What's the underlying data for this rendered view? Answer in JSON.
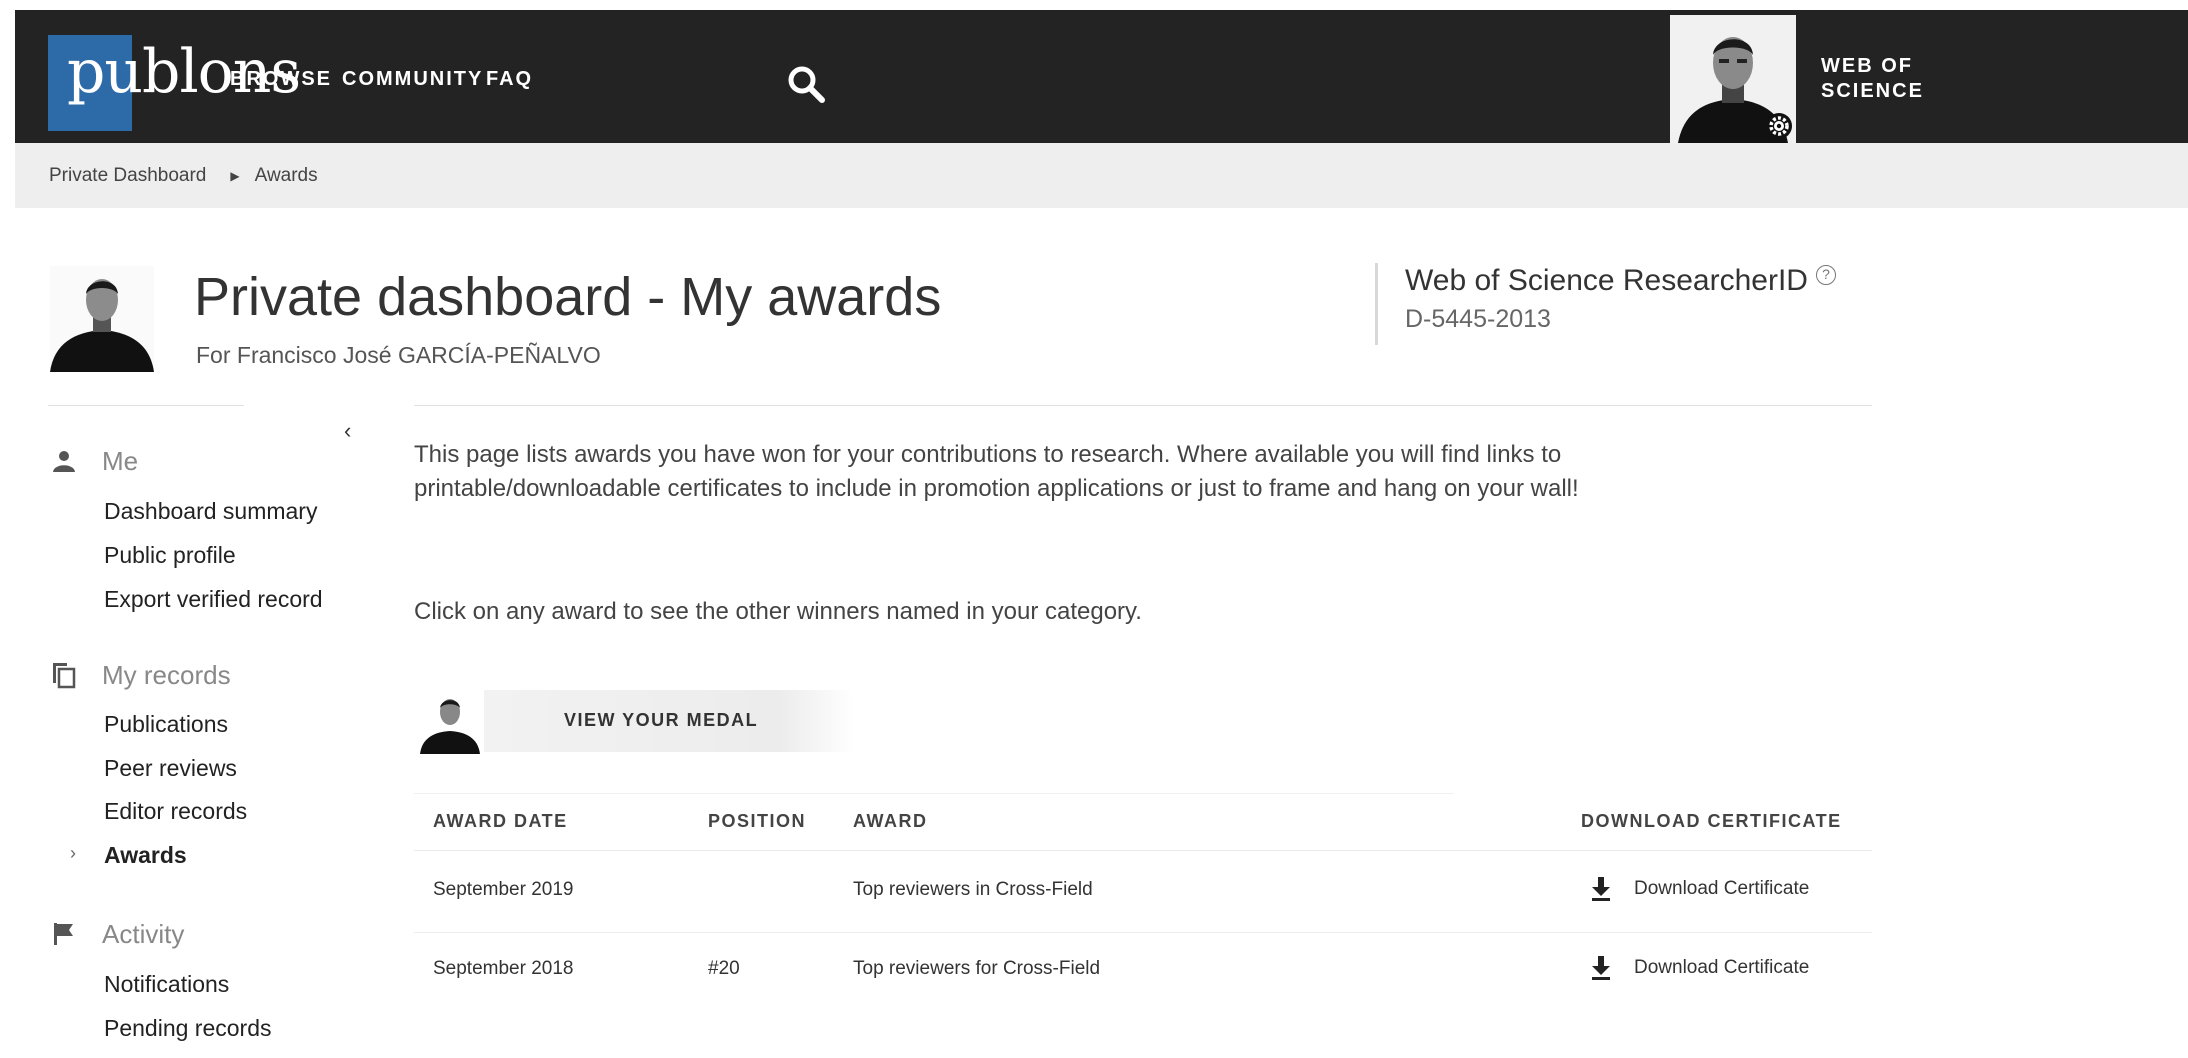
{
  "nav": {
    "logo": "publons",
    "links": [
      "BROWSE",
      "COMMUNITY",
      "FAQ"
    ],
    "wos_line1": "WEB OF",
    "wos_line2": "SCIENCE"
  },
  "breadcrumb": {
    "items": [
      "Private Dashboard",
      "Awards"
    ]
  },
  "header": {
    "title": "Private dashboard - My awards",
    "subtitle": "For Francisco José GARCÍA-PEÑALVO",
    "researcher_id_label": "Web of Science ResearcherID",
    "researcher_id_help": "?",
    "researcher_id": "D-5445-2013"
  },
  "sidebar": {
    "collapse": "‹",
    "sections": [
      {
        "title": "Me",
        "icon": "person-icon",
        "items": [
          "Dashboard summary",
          "Public profile",
          "Export verified record"
        ]
      },
      {
        "title": "My records",
        "icon": "copy-icon",
        "items": [
          "Publications",
          "Peer reviews",
          "Editor records",
          "Awards"
        ]
      },
      {
        "title": "Activity",
        "icon": "flag-icon",
        "items": [
          "Notifications",
          "Pending records"
        ]
      }
    ],
    "active_item": "Awards"
  },
  "content": {
    "intro": "This page lists awards you have won for your contributions to research. Where available you will find links to printable/downloadable certificates to include in promotion applications or just to frame and hang on your wall!",
    "hint": "Click on any award to see the other winners named in your category.",
    "medal_button": "VIEW YOUR MEDAL",
    "table": {
      "headers": [
        "AWARD DATE",
        "POSITION",
        "AWARD",
        "DOWNLOAD CERTIFICATE"
      ],
      "rows": [
        {
          "date": "September 2019",
          "position": "",
          "award": "Top reviewers in Cross-Field",
          "download": "Download Certificate"
        },
        {
          "date": "September 2018",
          "position": "#20",
          "award": "Top reviewers for Cross-Field",
          "download": "Download Certificate"
        }
      ]
    }
  },
  "colors": {
    "topbar": "#232323",
    "logo_bg": "#2c6aa8",
    "breadcrumb_bg": "#eeeeee"
  }
}
